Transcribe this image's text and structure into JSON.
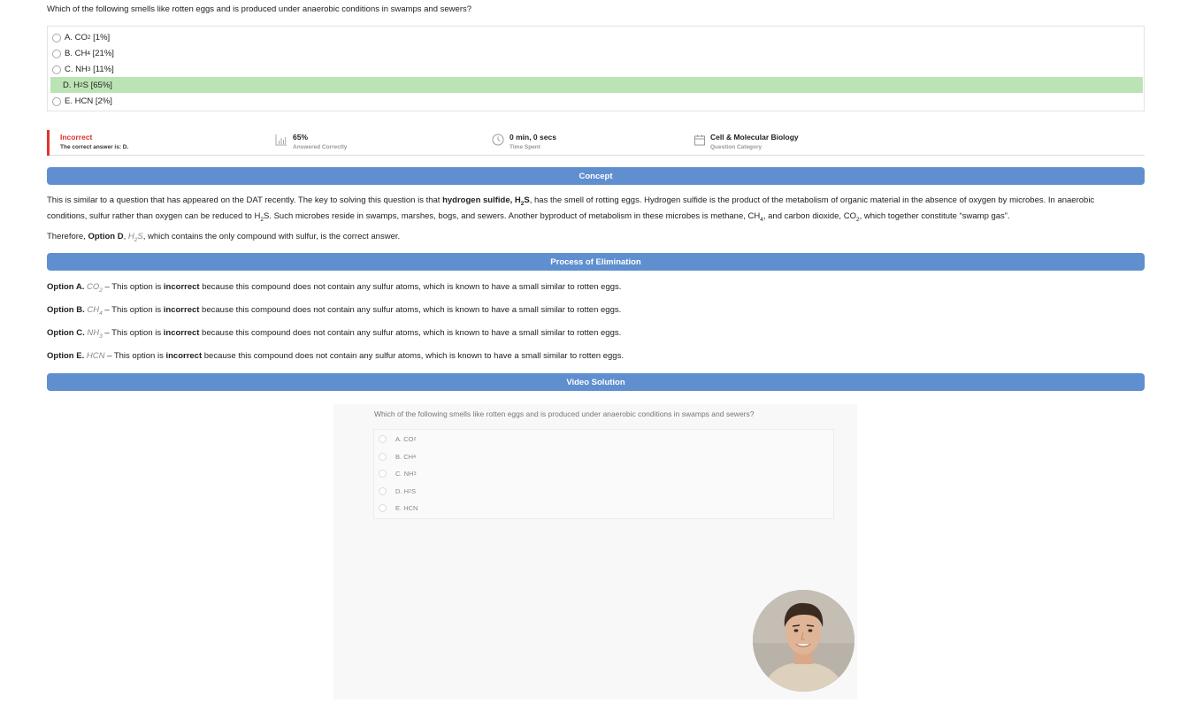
{
  "question": {
    "text": "Which of the following smells like rotten eggs and is produced under anaerobic conditions in swamps and sewers?"
  },
  "options": [
    {
      "letter": "A.",
      "base": "CO",
      "sub": "2",
      "suffix": "",
      "pct": "[1%]"
    },
    {
      "letter": "B.",
      "base": "CH",
      "sub": "4",
      "suffix": "",
      "pct": "[21%]"
    },
    {
      "letter": "C.",
      "base": "NH",
      "sub": "3",
      "suffix": "",
      "pct": "[11%]"
    },
    {
      "letter": "D.",
      "base": "H",
      "sub": "2",
      "suffix": "S",
      "pct": "[65%]"
    },
    {
      "letter": "E.",
      "base": "HCN",
      "sub": "",
      "suffix": "",
      "pct": "[2%]"
    }
  ],
  "stats": {
    "result": "Incorrect",
    "correct_answer": "The correct answer is: D.",
    "pct": "65%",
    "pct_label": "Answered Correctly",
    "time": "0 min, 0 secs",
    "time_label": "Time Spent",
    "category": "Cell & Molecular Biology",
    "category_label": "Question Category"
  },
  "sections": {
    "concept": "Concept",
    "elimination": "Process of Elimination",
    "video": "Video Solution"
  },
  "concept": {
    "p1_a": "This is similar to a question that has appeared on the DAT recently. The key to solving this question is that ",
    "p1_bold_a": "hydrogen sulfide, H",
    "p1_bold_sub": "2",
    "p1_bold_b": "S",
    "p1_b": ", has the smell of rotting eggs. Hydrogen sulfide is the product of the metabolism of organic material in the absence of oxygen by microbes. In anaerobic conditions, sulfur rather than oxygen can be reduced to H",
    "p1_sub1": "2",
    "p1_c": "S. Such microbes reside in swamps, marshes, bogs, and sewers. Another byproduct of metabolism in these microbes is methane, CH",
    "p1_sub2": "4",
    "p1_d": ", and carbon dioxide, CO",
    "p1_sub3": "2",
    "p1_e": ", which together constitute “swamp gas”.",
    "p2_a": "Therefore, ",
    "p2_bold": "Option D",
    "p2_b": ", ",
    "p2_it_a": "H",
    "p2_it_sub": "2",
    "p2_it_b": "S",
    "p2_c": ", which contains the only compound with sulfur, is the correct answer."
  },
  "elimination": [
    {
      "label": "Option A.",
      "it_a": "CO",
      "it_sub": "2",
      "mid": " – This option is ",
      "bold": "incorrect",
      "rest": " because this compound does not contain any sulfur atoms, which is known to have a small similar to rotten eggs."
    },
    {
      "label": "Option B.",
      "it_a": "CH",
      "it_sub": "4",
      "mid": " – This option is ",
      "bold": "incorrect",
      "rest": " because this compound does not contain any sulfur atoms, which is known to have a small similar to rotten eggs."
    },
    {
      "label": "Option C.",
      "it_a": "NH",
      "it_sub": "3",
      "mid": " – This option is ",
      "bold": "incorrect",
      "rest": " because this compound does not contain any sulfur atoms, which is known to have a small similar to rotten eggs."
    },
    {
      "label": "Option E.",
      "it_a": "HCN",
      "it_sub": "",
      "mid": " – This option is ",
      "bold": "incorrect",
      "rest": " because this compound does not contain any sulfur atoms, which is known to have a small similar to rotten eggs."
    }
  ],
  "video": {
    "question": "Which of the following smells like rotten eggs and is produced under anaerobic conditions in swamps and sewers?",
    "options": [
      {
        "letter": "A.",
        "base": "CO",
        "sub": "2",
        "suffix": ""
      },
      {
        "letter": "B.",
        "base": "CH",
        "sub": "4",
        "suffix": ""
      },
      {
        "letter": "C.",
        "base": "NH",
        "sub": "3",
        "suffix": ""
      },
      {
        "letter": "D.",
        "base": "H",
        "sub": "2",
        "suffix": "S"
      },
      {
        "letter": "E.",
        "base": "HCN",
        "sub": "",
        "suffix": ""
      }
    ]
  },
  "colors": {
    "banner": "#5f8fcf",
    "correct_highlight": "#bce3b4",
    "incorrect_red": "#e0342c"
  },
  "icons": [
    "bar-chart-icon",
    "clock-icon",
    "calendar-icon",
    "presenter-avatar"
  ]
}
